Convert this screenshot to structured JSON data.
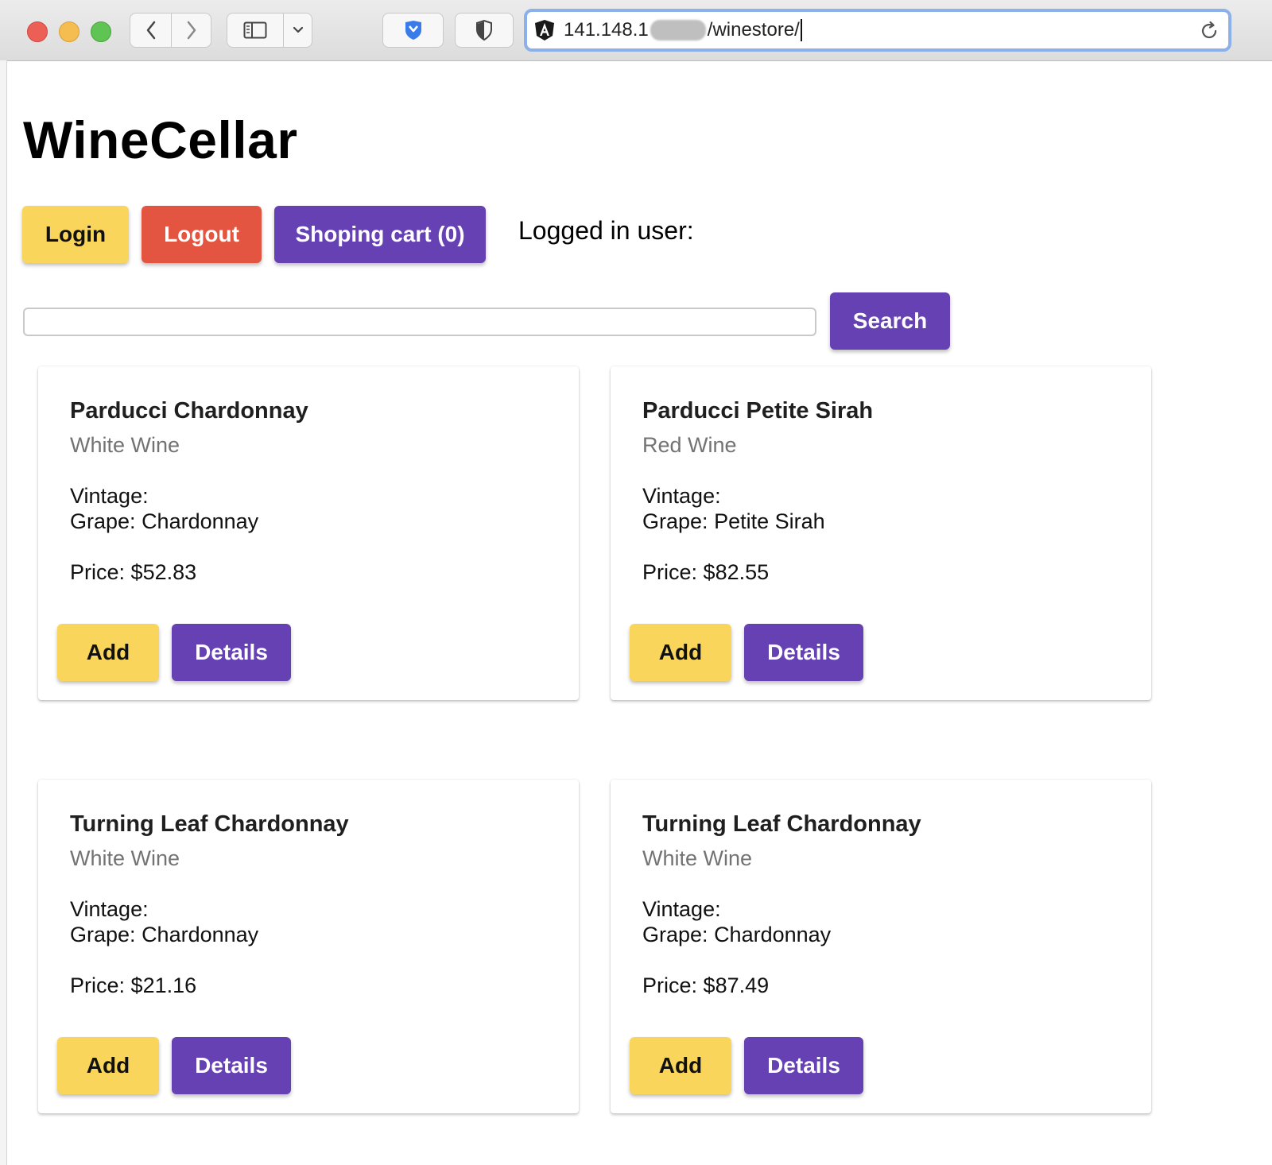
{
  "browser": {
    "url_prefix": "141.148.1",
    "url_suffix": "/winestore/"
  },
  "page": {
    "title": "WineCellar",
    "buttons": {
      "login": "Login",
      "logout": "Logout",
      "cart": "Shoping cart (0)"
    },
    "logged_in_label": "Logged in user:",
    "search": {
      "value": "",
      "button": "Search"
    }
  },
  "labels": {
    "vintage": "Vintage:",
    "grape_prefix": "Grape:",
    "price_prefix": "Price:",
    "add": "Add",
    "details": "Details"
  },
  "wines": [
    {
      "name": "Parducci Chardonnay",
      "type": "White Wine",
      "vintage": "",
      "grape": "Chardonnay",
      "price": "$52.83"
    },
    {
      "name": "Parducci Petite Sirah",
      "type": "Red Wine",
      "vintage": "",
      "grape": "Petite Sirah",
      "price": "$82.55"
    },
    {
      "name": "Turning Leaf Chardonnay",
      "type": "White Wine",
      "vintage": "",
      "grape": "Chardonnay",
      "price": "$21.16"
    },
    {
      "name": "Turning Leaf Chardonnay",
      "type": "White Wine",
      "vintage": "",
      "grape": "Chardonnay",
      "price": "$87.49"
    }
  ],
  "colors": {
    "yellow": "#f9d55c",
    "red": "#e35540",
    "purple": "#6541b4"
  }
}
